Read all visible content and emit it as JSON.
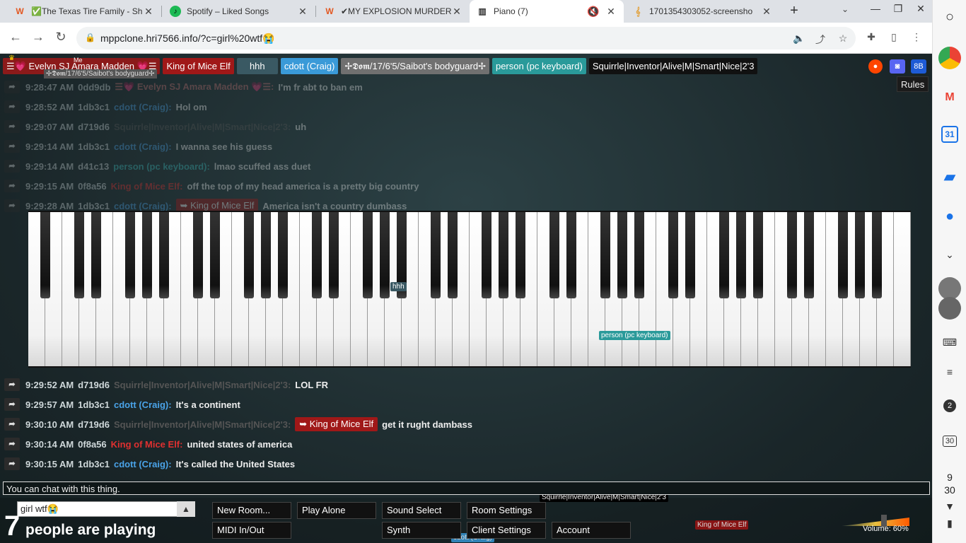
{
  "tabs": [
    {
      "title": "✅The Texas Tire Family - Sh",
      "icon": "W",
      "color": "#e25822"
    },
    {
      "title": "Spotify – Liked Songs",
      "icon": "♪",
      "color": "#1db954"
    },
    {
      "title": "✔MY EXPLOSION MURDER AN",
      "icon": "W",
      "color": "#e25822"
    },
    {
      "title": "Piano (7)",
      "icon": "▥",
      "color": "#333"
    },
    {
      "title": "1701354303052-screensho",
      "icon": "𝄞",
      "color": "#e2a13b"
    }
  ],
  "url": "mppclone.hri7566.info/?c=girl%20wtf😭",
  "users": [
    {
      "name": "☰💗 Evelyn SJ Amara Madden 💗☰",
      "color": "#8b1a1a"
    },
    {
      "name": "King of Mice Elf",
      "color": "#a01818"
    },
    {
      "name": "hhh",
      "color": "#3a5963"
    },
    {
      "name": "cdott (Craig)",
      "color": "#3a9ad8"
    },
    {
      "name": "✢𝕯𝖔𝖒/17/6'5/Saibot's bodyguard✢",
      "color": "#707070"
    },
    {
      "name": "person (pc keyboard)",
      "color": "#2a9a9a"
    },
    {
      "name": "Squirrle|Inventor|Alive|M|Smart|Nice|2'3",
      "color": "#111111"
    }
  ],
  "userhint": "✢𝕯𝖔𝖒/17/6'5/Saibot's bodyguard✢",
  "me_label": "Me",
  "rules_label": "Rules",
  "top_icons": {
    "reddit": "●",
    "discord": "◙",
    "bb": "8B"
  },
  "messages": [
    {
      "time": "9:28:47 AM",
      "uid": "0dd9db",
      "name": "☰💗 Evelyn SJ Amara Madden 💗☰:",
      "color": "#c27171",
      "text": "I'm fr abt to ban em",
      "faded": true
    },
    {
      "time": "9:28:52 AM",
      "uid": "1db3c1",
      "name": "cdott (Craig):",
      "color": "#4aa3e8",
      "text": "Hol om",
      "faded": true
    },
    {
      "time": "9:29:07 AM",
      "uid": "d719d6",
      "name": "Squirrle|Inventor|Alive|M|Smart|Nice|2'3:",
      "color": "#555",
      "text": "uh",
      "faded": true
    },
    {
      "time": "9:29:14 AM",
      "uid": "1db3c1",
      "name": "cdott (Craig):",
      "color": "#4aa3e8",
      "text": "I wanna see his guess",
      "faded": true
    },
    {
      "time": "9:29:14 AM",
      "uid": "d41c13",
      "name": "person (pc keyboard):",
      "color": "#3cbcbc",
      "text": "lmao scuffed ass duet",
      "faded": true
    },
    {
      "time": "9:29:15 AM",
      "uid": "0f8a56",
      "name": "King of Mice Elf:",
      "color": "#e03030",
      "text": "off the top of my head america is a pretty big country",
      "faded": true
    },
    {
      "time": "9:29:28 AM",
      "uid": "1db3c1",
      "name": "cdott (Craig):",
      "color": "#4aa3e8",
      "reply": "➥ King of Mice Elf",
      "text": "America isn't a country dumbass",
      "faded": true
    },
    {
      "time": "9:29:52 AM",
      "uid": "d719d6",
      "name": "Squirrle|Inventor|Alive|M|Smart|Nice|2'3:",
      "color": "#555",
      "text": "LOL FR",
      "faded": false
    },
    {
      "time": "9:29:57 AM",
      "uid": "1db3c1",
      "name": "cdott (Craig):",
      "color": "#4aa3e8",
      "text": "It's a continent",
      "faded": false
    },
    {
      "time": "9:30:10 AM",
      "uid": "d719d6",
      "name": "Squirrle|Inventor|Alive|M|Smart|Nice|2'3:",
      "color": "#555",
      "reply": "➥ King of Mice Elf",
      "text": "get it rught dambass",
      "faded": false
    },
    {
      "time": "9:30:14 AM",
      "uid": "0f8a56",
      "name": "King of Mice Elf:",
      "color": "#e03030",
      "text": "united states of america",
      "faded": false
    },
    {
      "time": "9:30:15 AM",
      "uid": "1db3c1",
      "name": "cdott (Craig):",
      "color": "#4aa3e8",
      "text": "It's called the United States",
      "faded": false
    }
  ],
  "cursor_labels": [
    {
      "name": "hhh",
      "color": "#3a5963"
    },
    {
      "name": "person (pc keyboard)",
      "color": "#2a9a9a"
    },
    {
      "name": "Squirrle|Inventor|Alive|M|Smart|Nice|2'3",
      "color": "#000000"
    },
    {
      "name": "King of Mice Elf",
      "color": "#a01818"
    },
    {
      "name": "cdott (Craig)",
      "color": "#3a9ad8"
    }
  ],
  "chat_placeholder": "You can chat with this thing.",
  "room_name": "girl wtf😭",
  "player_count": "7",
  "player_label": "people are playing",
  "buttons": {
    "new_room": "New Room...",
    "play_alone": "Play Alone",
    "sound_select": "Sound Select",
    "room_settings": "Room Settings",
    "midi": "MIDI In/Out",
    "synth": "Synth",
    "client_settings": "Client Settings",
    "account": "Account"
  },
  "volume": "Volume: 60%",
  "volume_level": 0.6,
  "shelf": {
    "badge": "2",
    "cal": "30",
    "time_h": "9",
    "time_m": "30"
  }
}
